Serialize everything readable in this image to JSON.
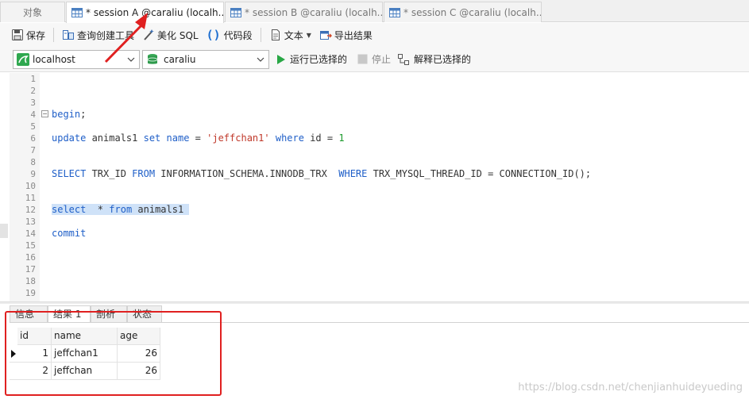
{
  "tabs": [
    {
      "label": "对象",
      "active": false
    },
    {
      "label": "* session A @caraliu (localh...",
      "active": true
    },
    {
      "label": "* session B @caraliu (localh...",
      "active": false
    },
    {
      "label": "* session C @caraliu (localh...",
      "active": false
    }
  ],
  "toolbar": {
    "save": "保存",
    "query_builder": "查询创建工具",
    "beautify": "美化 SQL",
    "snippet": "代码段",
    "text": "文本",
    "export": "导出结果"
  },
  "toolbar2": {
    "connection": "localhost",
    "database": "caraliu",
    "run_selected": "运行已选择的",
    "stop": "停止",
    "explain_selected": "解释已选择的"
  },
  "editor": {
    "line_numbers": [
      "1",
      "2",
      "3",
      "4",
      "5",
      "6",
      "7",
      "8",
      "9",
      "10",
      "11",
      "12",
      "13",
      "14",
      "15",
      "16",
      "17",
      "18",
      "19"
    ],
    "lines": {
      "l4_kw": "begin",
      "l4_rest": ";",
      "l6_kw1": "update",
      "l6_t1": " animals1 ",
      "l6_kw2": "set",
      "l6_t2": " ",
      "l6_kw3": "name",
      "l6_t3": " = ",
      "l6_str": "'jeffchan1'",
      "l6_t4": " ",
      "l6_kw4": "where",
      "l6_t5": " id = ",
      "l6_num": "1",
      "l9_kw1": "SELECT",
      "l9_t1": " TRX_ID ",
      "l9_kw2": "FROM",
      "l9_t2": " INFORMATION_SCHEMA.INNODB_TRX  ",
      "l9_kw3": "WHERE",
      "l9_t3": " TRX_MYSQL_THREAD_ID = CONNECTION_ID();",
      "l12_kw1": "select",
      "l12_t1": "  * ",
      "l12_kw2": "from",
      "l12_t2": " animals1 ",
      "l14_kw": "commit"
    }
  },
  "result_tabs": [
    {
      "label": "信息",
      "active": false
    },
    {
      "label": "结果 1",
      "active": true
    },
    {
      "label": "剖析",
      "active": false
    },
    {
      "label": "状态",
      "active": false
    }
  ],
  "result": {
    "columns": [
      "id",
      "name",
      "age"
    ],
    "rows": [
      [
        "1",
        "jeffchan1",
        "26"
      ],
      [
        "2",
        "jeffchan",
        "26"
      ]
    ]
  },
  "watermark": "https://blog.csdn.net/chenjianhuideyueding",
  "colors": {
    "annotation": "#e02020",
    "keyword": "#1f5fc8",
    "string": "#c0392b",
    "number": "#1a9a2a",
    "selection": "#cfe2f8"
  }
}
